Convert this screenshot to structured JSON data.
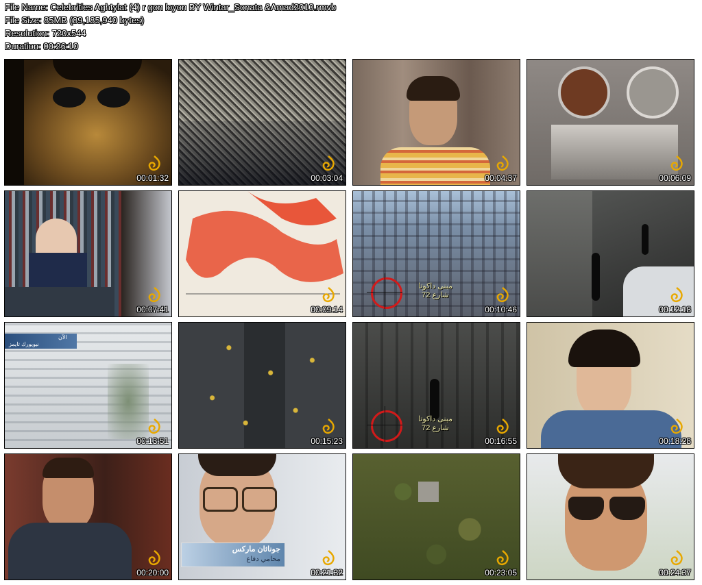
{
  "info": {
    "file_name": "File Name: Celebrities Aghtylat (4)  r gon loyon BY Wintar_Sonata &Amad2010.rmvb",
    "file_size": "File Size: 85MB (89,185,940 bytes)",
    "resolution": "Resolution: 720x544",
    "duration": "Duration: 00:26:10"
  },
  "thumbnails": [
    {
      "time": "00:01:32"
    },
    {
      "time": "00:03:04"
    },
    {
      "time": "00:04:37"
    },
    {
      "time": "00:06:09"
    },
    {
      "time": "00:07:41"
    },
    {
      "time": "00:09:14"
    },
    {
      "time": "00:10:46",
      "caption_line1": "مبنى داكوتا",
      "caption_line2": "شارع 72"
    },
    {
      "time": "00:12:18"
    },
    {
      "time": "00:13:51",
      "bar_line1": "الآن",
      "bar_line2": "نيويورك تايمز"
    },
    {
      "time": "00:15:23"
    },
    {
      "time": "00:16:55",
      "caption_line1": "مبنى داكوتا",
      "caption_line2": "شارع 72"
    },
    {
      "time": "00:18:28"
    },
    {
      "time": "00:20:00"
    },
    {
      "time": "00:21:32",
      "name": "جوناثان ماركس",
      "role": "محامي دفاع"
    },
    {
      "time": "00:23:05"
    },
    {
      "time": "00:24:37"
    }
  ],
  "colors": {
    "accent_logo": "#e8a800",
    "caption_text": "#e7e3a0",
    "scope_red": "#d21a1a"
  }
}
